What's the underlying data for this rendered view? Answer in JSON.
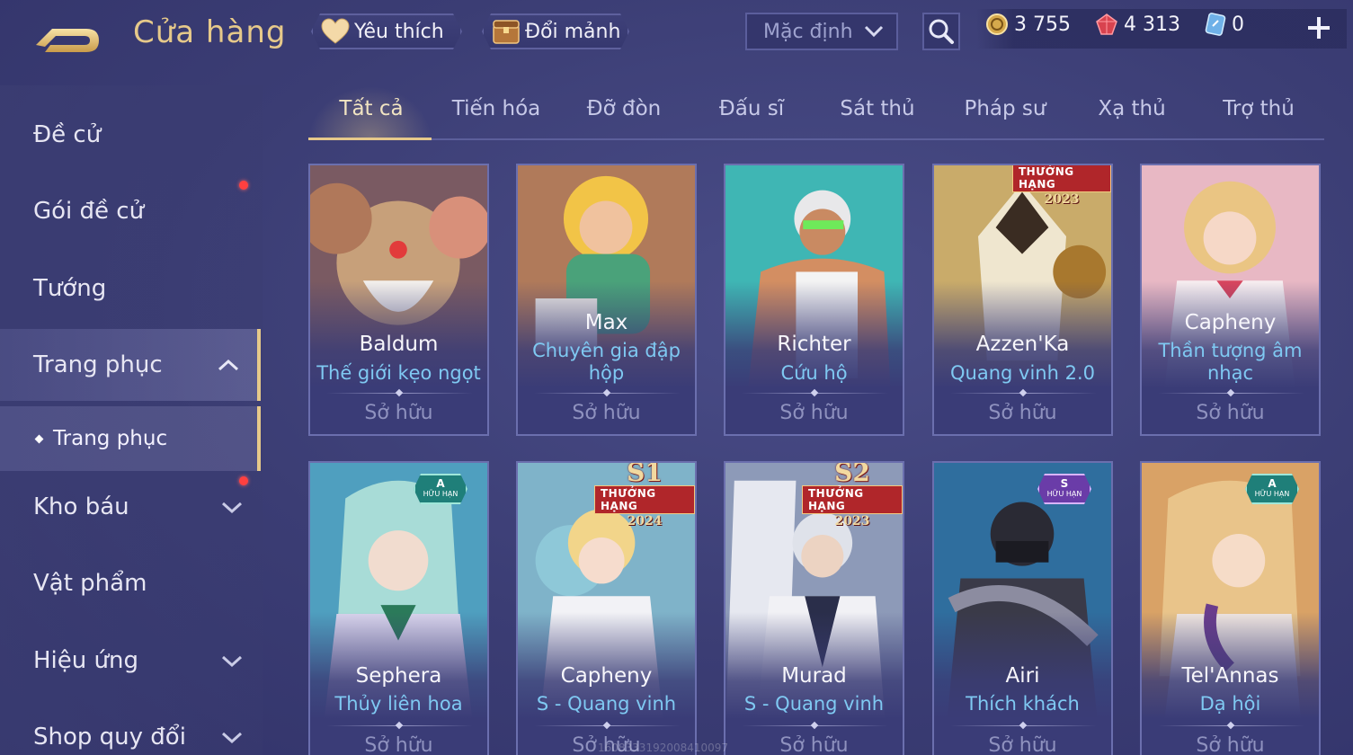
{
  "header": {
    "title": "Cửa hàng",
    "favorites_label": "Yêu thích",
    "exchange_label": "Đổi mảnh",
    "sort_value": "Mặc định",
    "currencies": [
      {
        "name": "gold",
        "value": "3 755"
      },
      {
        "name": "gem",
        "value": "4 313"
      },
      {
        "name": "card",
        "value": "0"
      }
    ]
  },
  "sidebar": {
    "items": [
      {
        "label": "Đề cử"
      },
      {
        "label": "Gói đề cử"
      },
      {
        "label": "Tướng"
      },
      {
        "label": "Trang phục"
      },
      {
        "label": "Trang phục"
      },
      {
        "label": "Kho báu"
      },
      {
        "label": "Vật phẩm"
      },
      {
        "label": "Hiệu ứng"
      },
      {
        "label": "Shop quy đổi"
      }
    ]
  },
  "tabs": [
    "Tất cả",
    "Tiến hóa",
    "Đỡ đòn",
    "Đấu sĩ",
    "Sát thủ",
    "Pháp sư",
    "Xạ thủ",
    "Trợ thủ"
  ],
  "cards": [
    {
      "hero": "Baldum",
      "skin": "Thế giới kẹo ngọt",
      "status": "Sở hữu"
    },
    {
      "hero": "Max",
      "skin": "Chuyên gia đập hộp",
      "status": "Sở hữu"
    },
    {
      "hero": "Richter",
      "skin": "Cứu hộ",
      "status": "Sở hữu"
    },
    {
      "hero": "Azzen'Ka",
      "skin": "Quang vinh 2.0",
      "status": "Sở hữu",
      "badge": {
        "label": "THƯỞNG HẠNG",
        "year": "2023"
      }
    },
    {
      "hero": "Capheny",
      "skin": "Thần tượng âm nhạc",
      "status": "Sở hữu"
    },
    {
      "hero": "Sephera",
      "skin": "Thủy liên hoa",
      "status": "Sở hữu",
      "tier": {
        "level": "A",
        "note": "HỮU HẠN"
      }
    },
    {
      "hero": "Capheny",
      "skin": "S - Quang vinh",
      "status": "Sở hữu",
      "badge": {
        "season": "S1",
        "label": "THƯỞNG HẠNG",
        "year": "2024"
      }
    },
    {
      "hero": "Murad",
      "skin": "S - Quang vinh",
      "status": "Sở hữu",
      "badge": {
        "season": "S2",
        "label": "THƯỞNG HẠNG",
        "year": "2023"
      }
    },
    {
      "hero": "Airi",
      "skin": "Thích khách",
      "status": "Sở hữu",
      "tier": {
        "level": "S",
        "note": "HỮU HẠN"
      }
    },
    {
      "hero": "Tel'Annas",
      "skin": "Dạ hội",
      "status": "Sở hữu",
      "tier": {
        "level": "A",
        "note": "HỮU HẠN"
      }
    }
  ],
  "watermark": "1608333192008410097",
  "colors": {
    "accent_gold": "#e6c98a",
    "skin_name": "#7fc9f2",
    "owned_text": "#8f92bf",
    "background": "#3b3d73",
    "notification_red": "#ff4040"
  }
}
